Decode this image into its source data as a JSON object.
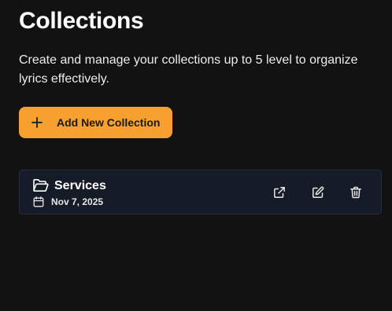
{
  "header": {
    "title": "Collections",
    "description": "Create and manage your collections up to 5 level to organize lyrics effectively."
  },
  "actions": {
    "add_label": "Add New Collection",
    "add_icon": "plus-icon"
  },
  "colors": {
    "background": "#121212",
    "accent": "#f6a12f",
    "card_background": "#161b28"
  },
  "collections": [
    {
      "name": "Services",
      "date": "Nov 7, 2025",
      "icons": [
        "folder-open-icon",
        "calendar-icon",
        "external-link-icon",
        "edit-icon",
        "trash-icon"
      ]
    }
  ]
}
